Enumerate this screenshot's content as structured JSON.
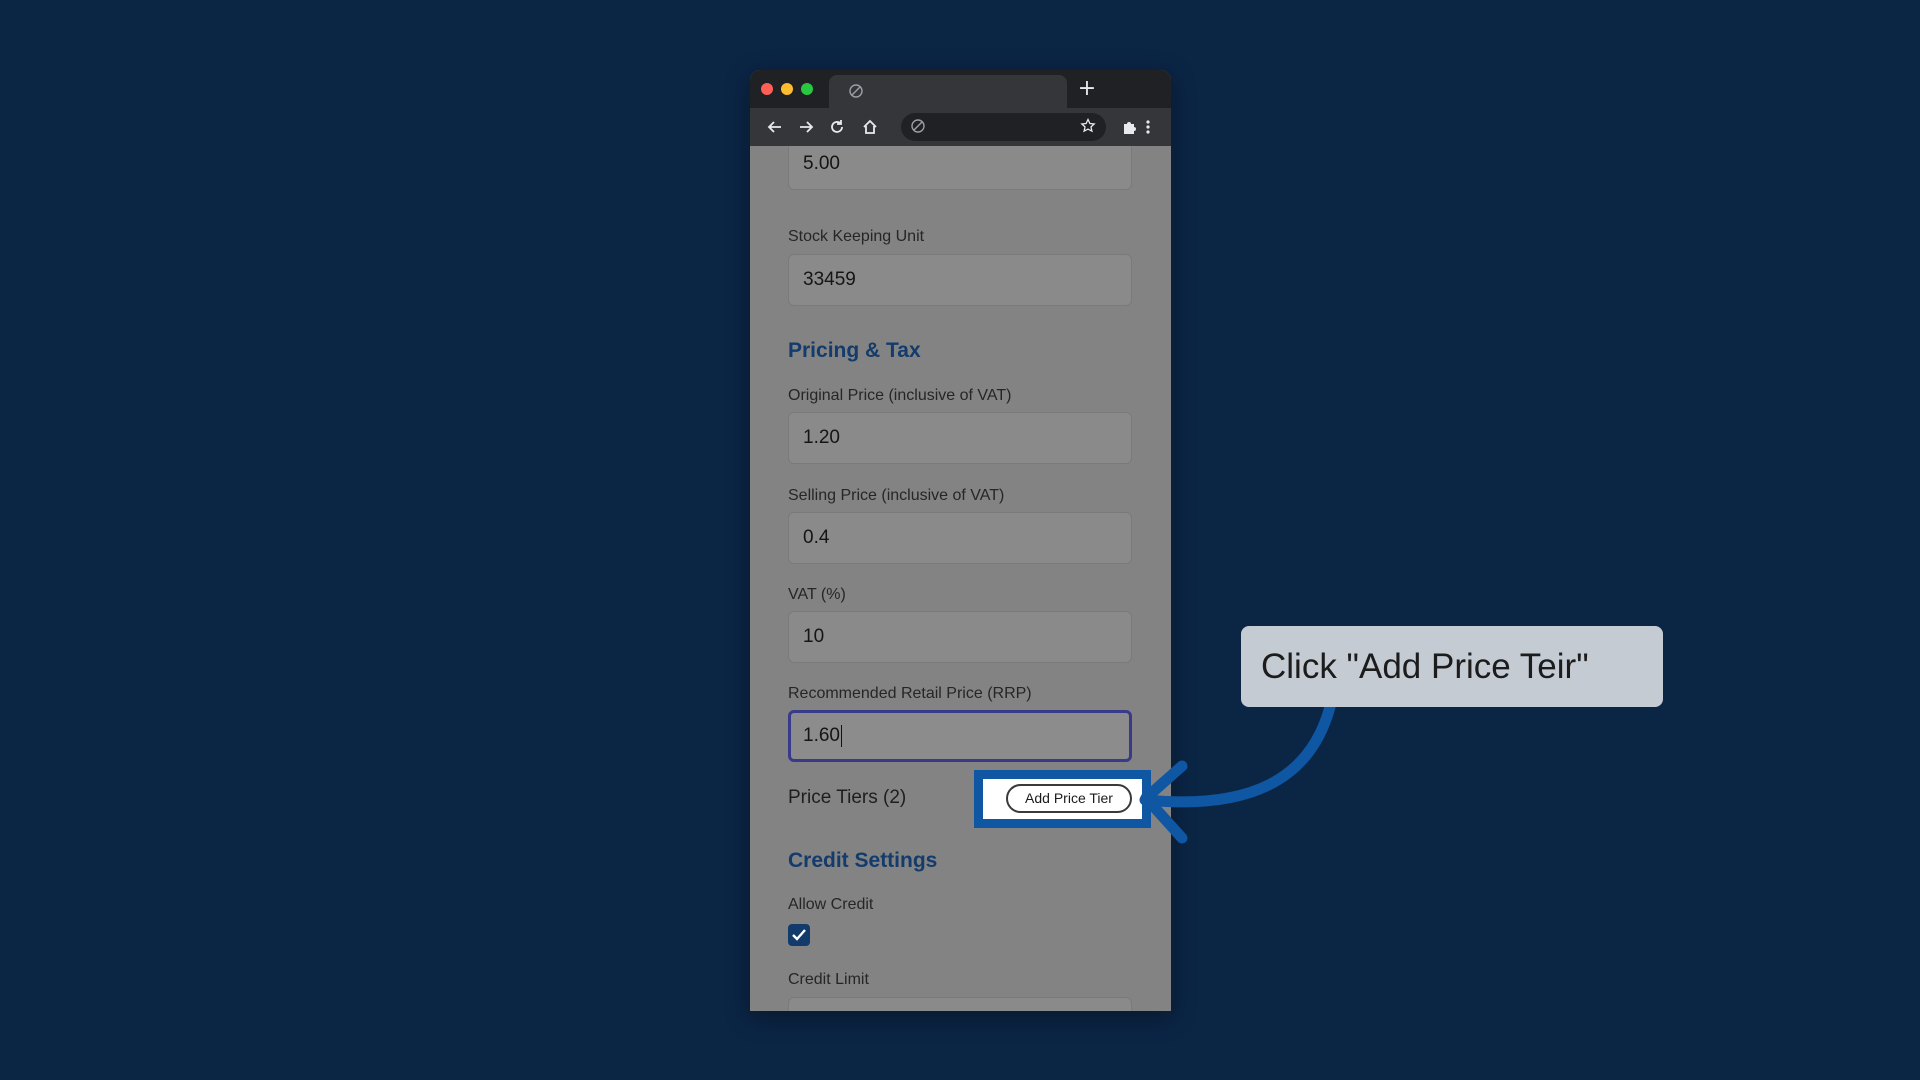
{
  "browser": {
    "icons": [
      "globe-icon",
      "new-tab-icon",
      "back-icon",
      "forward-icon",
      "reload-icon",
      "home-icon",
      "bookmark-star-icon",
      "extensions-icon",
      "menu-icon"
    ]
  },
  "form": {
    "top_field_value": "5.00",
    "sku": {
      "label": "Stock Keeping Unit",
      "value": "33459"
    },
    "pricing_section_title": "Pricing & Tax",
    "original_price": {
      "label": "Original Price (inclusive of VAT)",
      "value": "1.20"
    },
    "selling_price": {
      "label": "Selling Price (inclusive of VAT)",
      "value": "0.4"
    },
    "vat": {
      "label": "VAT (%)",
      "value": "10"
    },
    "rrp": {
      "label": "Recommended Retail Price (RRP)",
      "value": "1.60"
    },
    "price_tiers_label": "Price Tiers (2)",
    "add_price_tier_label": "Add Price Tier",
    "credit_section_title": "Credit Settings",
    "allow_credit": {
      "label": "Allow Credit",
      "checked": true
    },
    "credit_limit_label": "Credit Limit"
  },
  "callout": {
    "text": "Click \"Add Price Teir\""
  },
  "colors": {
    "background": "#0b2545",
    "section_title": "#133b6b",
    "highlight": "#0f56a3",
    "callout_bg": "#c5cbd3"
  }
}
